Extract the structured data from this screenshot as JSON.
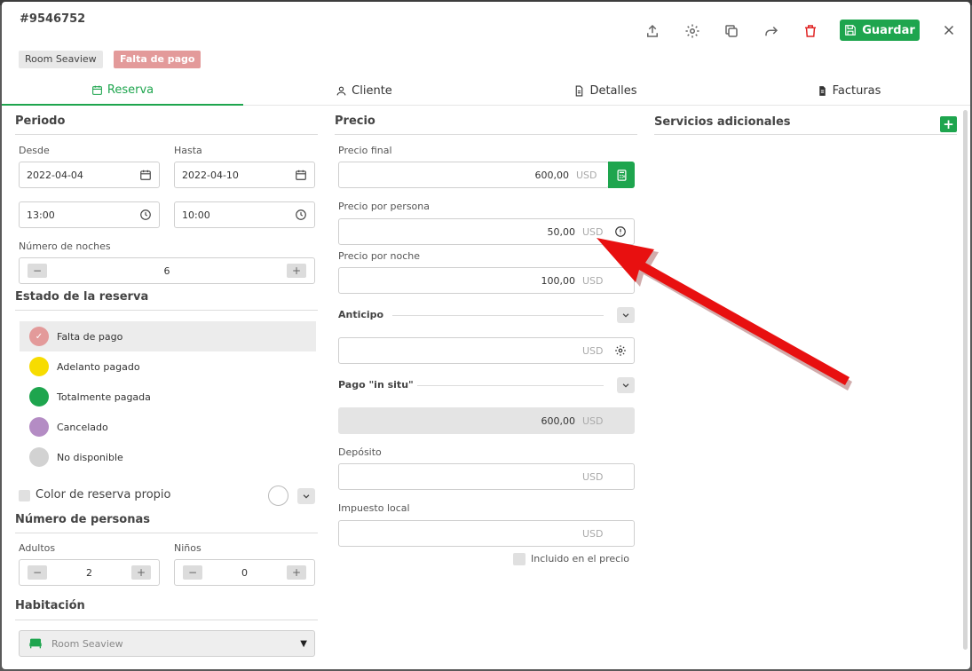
{
  "header": {
    "title": "#9546752",
    "tags": [
      "Room Seaview",
      "Falta de pago"
    ],
    "save_label": "Guardar",
    "icons": [
      "upload-icon",
      "gear-icon",
      "copy-icon",
      "share-icon",
      "trash-icon",
      "close-icon"
    ]
  },
  "tabs": [
    {
      "label": "Reserva",
      "icon": "calendar-icon"
    },
    {
      "label": "Cliente",
      "icon": "user-icon"
    },
    {
      "label": "Detalles",
      "icon": "document-icon"
    },
    {
      "label": "Facturas",
      "icon": "invoice-icon"
    }
  ],
  "periodo": {
    "heading": "Periodo",
    "desde_label": "Desde",
    "hasta_label": "Hasta",
    "desde_date": "2022-04-04",
    "hasta_date": "2022-04-10",
    "desde_time": "13:00",
    "hasta_time": "10:00",
    "nights_label": "Número de noches",
    "nights": "6"
  },
  "estado": {
    "heading": "Estado de la reserva",
    "items": [
      {
        "label": "Falta de pago",
        "color": "#e39a9a",
        "selected": true
      },
      {
        "label": "Adelanto pagado",
        "color": "#f7dc00"
      },
      {
        "label": "Totalmente pagada",
        "color": "#1ea54e"
      },
      {
        "label": "Cancelado",
        "color": "#b48cc4"
      },
      {
        "label": "No disponible",
        "color": "#d2d2d2"
      }
    ],
    "custom_color_label": "Color de reserva propio"
  },
  "personas": {
    "heading": "Número de personas",
    "adultos_label": "Adultos",
    "adultos": "2",
    "ninos_label": "Niños",
    "ninos": "0"
  },
  "habitacion": {
    "heading": "Habitación",
    "value": "Room Seaview"
  },
  "precio": {
    "heading": "Precio",
    "final_label": "Precio final",
    "final_value": "600,00",
    "persona_label": "Precio por persona",
    "persona_value": "50,00",
    "noche_label": "Precio por noche",
    "noche_value": "100,00",
    "anticipo_label": "Anticipo",
    "anticipo_value": "",
    "insitu_label": "Pago \"in situ\"",
    "insitu_value": "600,00",
    "deposito_label": "Depósito",
    "deposito_value": "",
    "impuesto_label": "Impuesto local",
    "impuesto_value": "",
    "currency": "USD",
    "incluido_label": "Incluido en el precio"
  },
  "servicios": {
    "heading": "Servicios adicionales"
  },
  "colors": {
    "accent": "#1ea54e",
    "arrow": "#e81010"
  }
}
